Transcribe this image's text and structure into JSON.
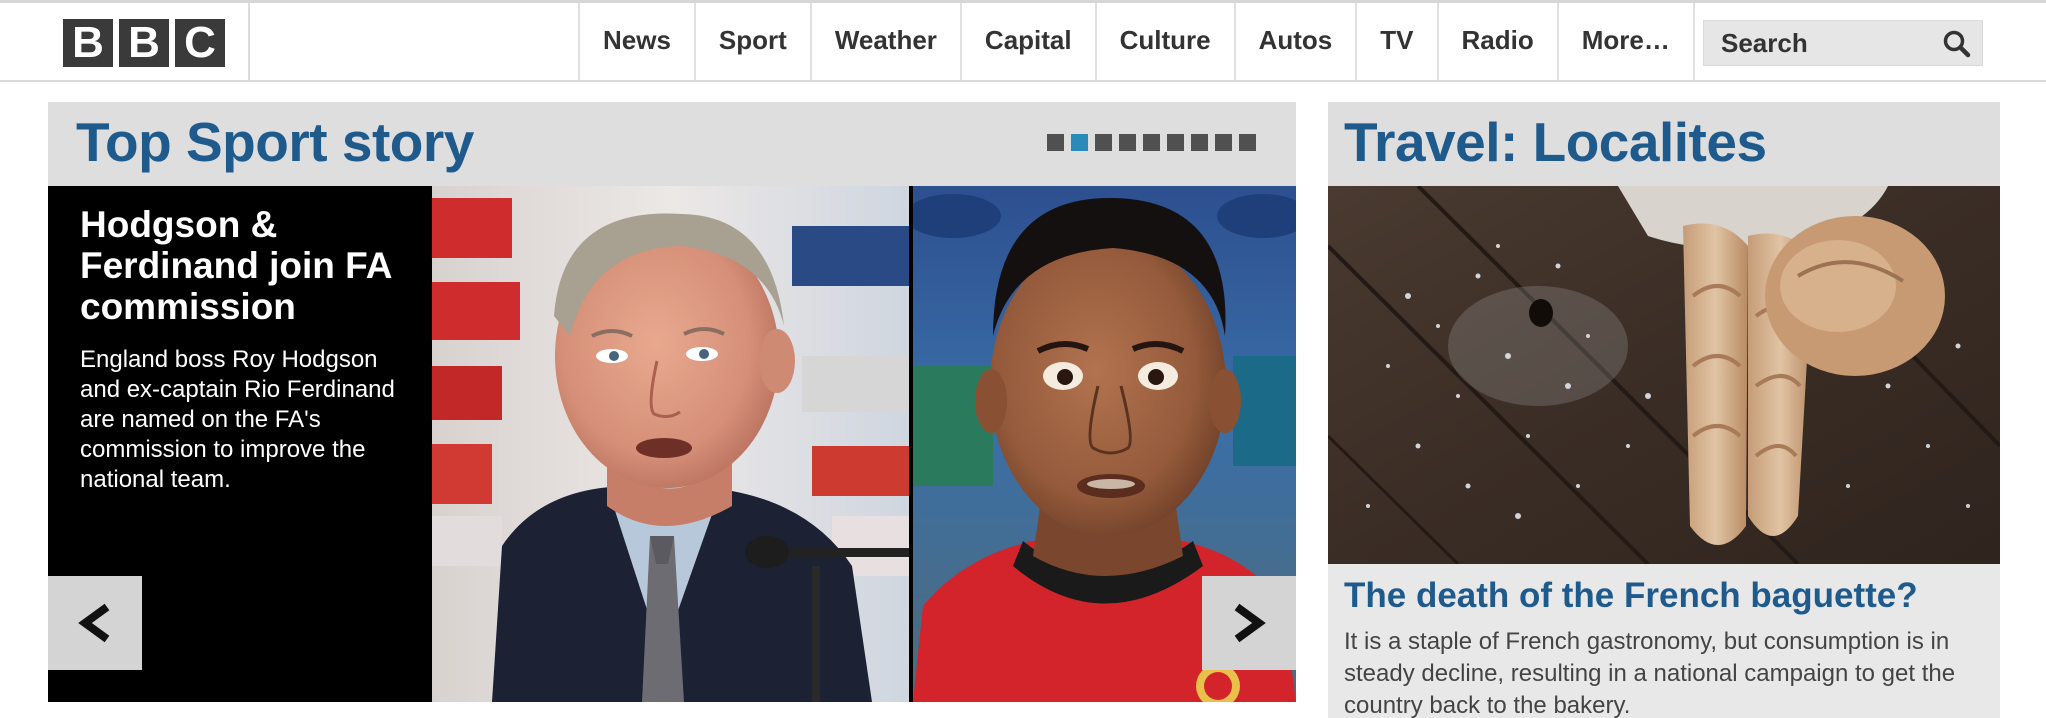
{
  "header": {
    "logo": [
      "B",
      "B",
      "C"
    ],
    "nav": [
      "News",
      "Sport",
      "Weather",
      "Capital",
      "Culture",
      "Autos",
      "TV",
      "Radio",
      "More…"
    ],
    "search": {
      "placeholder": "Search"
    }
  },
  "sport": {
    "section_title": "Top Sport story",
    "carousel": {
      "slide_count": 9,
      "active_slide": 2,
      "active_color": "#2b8bb8"
    },
    "headline": "Hodgson & Ferdinand join FA commission",
    "summary": "England boss Roy Hodgson and ex-captain Rio Ferdinand are named on the FA's commission to improve the national team.",
    "prev_icon": "chevron-left-icon",
    "next_icon": "chevron-right-icon"
  },
  "travel": {
    "section_title": "Travel: Localites",
    "headline": "The death of the French baguette?",
    "summary": "It is a staple of French gastronomy, but consumption is in steady decline, resulting in a national campaign to get the country back to the bakery."
  },
  "colors": {
    "title_blue": "#1f5a8c",
    "panel_grey": "#dedede",
    "logo_block": "#3a3a3a"
  }
}
